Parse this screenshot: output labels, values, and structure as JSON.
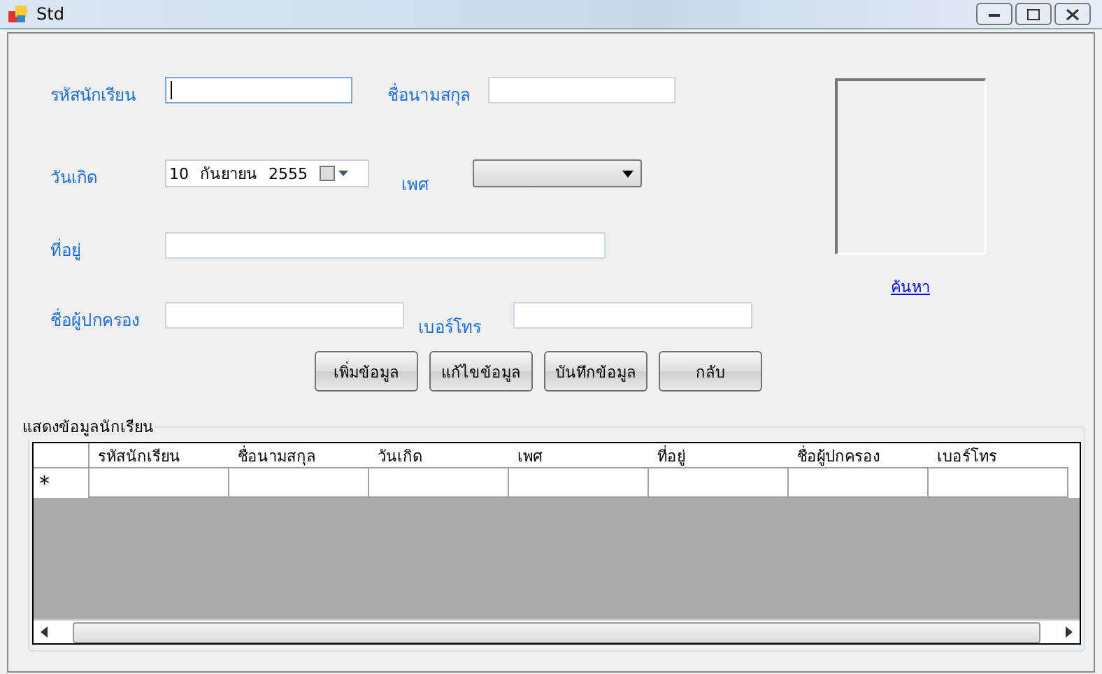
{
  "window": {
    "title": "Std"
  },
  "form": {
    "rows": [
      {
        "fields": [
          {
            "kind": "text",
            "label": "รหัสนักเรียน",
            "focused": true
          },
          {
            "kind": "text",
            "label": "ชื่อนามสกุล",
            "focused": false
          }
        ]
      },
      {
        "fields": [
          {
            "kind": "date",
            "label": "วันเกิด",
            "day": "10",
            "month": "กันยายน",
            "year": "2555"
          },
          {
            "kind": "combo",
            "label": "เพศ"
          }
        ]
      },
      {
        "fields": [
          {
            "kind": "text",
            "label": "ที่อยู่",
            "focused": false
          }
        ]
      },
      {
        "fields": [
          {
            "kind": "text",
            "label": "ชื่อผู้ปกครอง",
            "focused": false
          },
          {
            "kind": "text",
            "label": "เบอร์โทร",
            "focused": false
          }
        ]
      }
    ],
    "buttons": [
      "เพิ่มข้อมูล",
      "แก้ไขข้อมูล",
      "บันทึกข้อมูล",
      "กลับ"
    ],
    "photo_link": "ค้นหา"
  },
  "group": {
    "title": "แสดงข้อมูลนักเรียน",
    "grid": {
      "columns": [
        "รหัสนักเรียน",
        "ชื่อนามสกุล",
        "วันเกิด",
        "เพศ",
        "ที่อยู่",
        "ชื่อผู้ปกครอง",
        "เบอร์โทร"
      ],
      "new_row_marker": "*"
    }
  }
}
